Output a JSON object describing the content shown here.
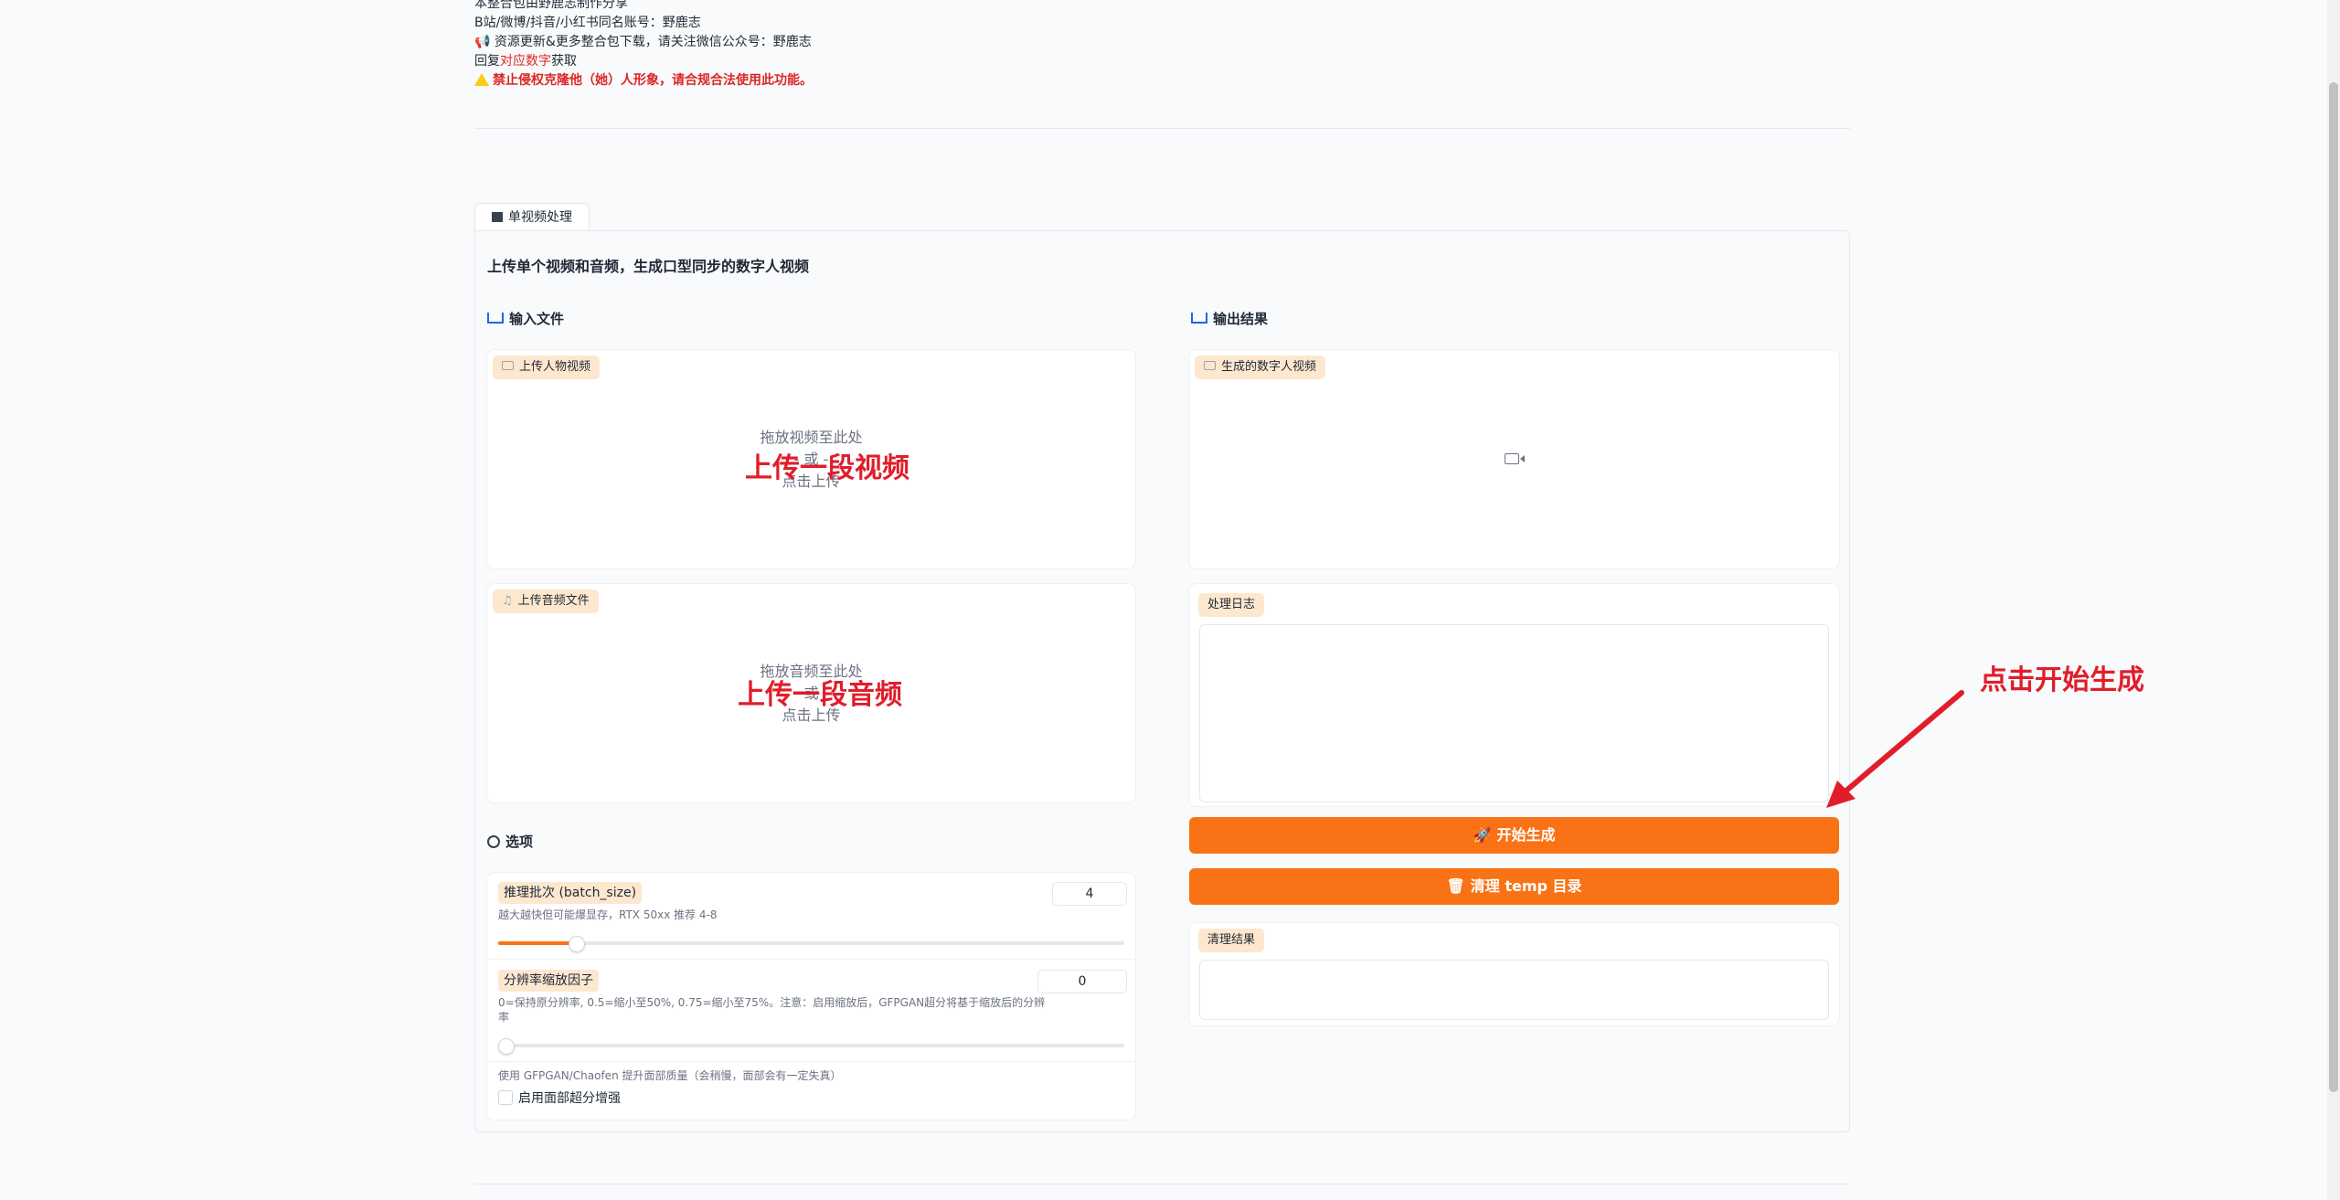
{
  "info": {
    "line1": "本整合包由野鹿志制作分享",
    "line2": "B站/微博/抖音/小红书同名账号：野鹿志",
    "line3": "📢 资源更新&更多整合包下载，请关注微信公众号：野鹿志",
    "line4_prefix": "回复",
    "line4_red": "对应数字",
    "line4_suffix": "获取",
    "line5": "禁止侵权克隆他（她）人形象，请合规合法使用此功能。"
  },
  "tab": {
    "label": "单视频处理"
  },
  "main": {
    "heading": "上传单个视频和音频，生成口型同步的数字人视频",
    "input_title": "输入文件",
    "output_title": "输出结果"
  },
  "video_upload": {
    "label": "上传人物视频",
    "drop_line1": "拖放视频至此处",
    "drop_line2": "- 或 -",
    "drop_line3": "点击上传",
    "overlay": "上传一段视频"
  },
  "audio_upload": {
    "label": "上传音频文件",
    "drop_line1": "拖放音频至此处",
    "drop_line2": "- 或 -",
    "drop_line3": "点击上传",
    "overlay": "上传一段音频"
  },
  "options": {
    "title": "选项",
    "batch": {
      "label": "推理批次 (batch_size)",
      "desc": "越大越快但可能爆显存，RTX 50xx 推荐 4-8",
      "value": "4",
      "min": 1,
      "max": 16,
      "level": 4
    },
    "scale": {
      "label": "分辨率缩放因子",
      "desc1": "0=保持原分辨率, 0.5=缩小至50%, 0.75=缩小至75%。注意：启用缩放后，GFPGAN超分将基于缩放后的分辨",
      "desc2": "率",
      "value": "0",
      "level": 0
    },
    "face": {
      "desc": "使用 GFPGAN/Chaofen 提升面部质量（会稍慢，面部会有一定失真）",
      "label": "启用面部超分增强"
    }
  },
  "output": {
    "video_label": "生成的数字人视频",
    "log_label": "处理日志",
    "start_button": "开始生成",
    "clean_button": "清理 temp 目录",
    "clean_label": "清理结果"
  },
  "annotation": {
    "text": "点击开始生成"
  },
  "colors": {
    "accent": "#f97316",
    "annotation": "#e11d2b",
    "chip": "#fde8cf"
  }
}
